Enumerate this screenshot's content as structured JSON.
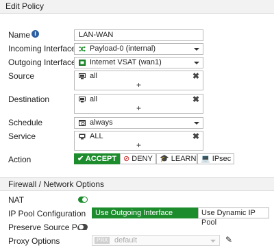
{
  "header": {
    "title": "Edit Policy"
  },
  "form": {
    "name_label": "Name",
    "name_value": "LAN-WAN",
    "incoming_label": "Incoming Interface",
    "incoming_value": "Payload-0 (internal)",
    "outgoing_label": "Outgoing Interface",
    "outgoing_value": "Internet VSAT (wan1)",
    "source_label": "Source",
    "source_value": "all",
    "destination_label": "Destination",
    "destination_value": "all",
    "schedule_label": "Schedule",
    "schedule_value": "always",
    "service_label": "Service",
    "service_value": "ALL",
    "add_symbol": "+",
    "remove_symbol": "✖",
    "action_label": "Action",
    "actions": [
      "ACCEPT",
      "DENY",
      "LEARN",
      "IPsec"
    ],
    "action_selected": "ACCEPT"
  },
  "section_firewall": {
    "title": "Firewall / Network Options",
    "nat_label": "NAT",
    "nat_enabled": true,
    "ippool_label": "IP Pool Configuration",
    "ippool_options": [
      "Use Outgoing Interface Address",
      "Use Dynamic IP Pool"
    ],
    "ippool_selected": "Use Outgoing Interface Address",
    "preserve_label": "Preserve Source Port",
    "preserve_enabled": false,
    "proxy_label": "Proxy Options",
    "proxy_tag": "PRX",
    "proxy_value": "default"
  },
  "colors": {
    "accent": "#1c8c2c",
    "info": "#2d5fa0",
    "deny": "#cc2222"
  }
}
